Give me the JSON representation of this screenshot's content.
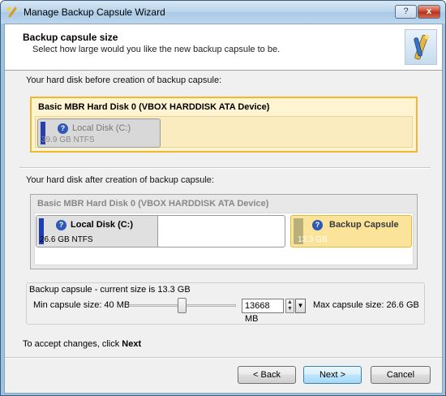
{
  "window": {
    "title": "Manage Backup Capsule Wizard",
    "help_label": "?",
    "close_label": "x"
  },
  "header": {
    "title": "Backup capsule size",
    "subtitle": "Select how large would you like the new backup capsule to be."
  },
  "before": {
    "label": "Your hard disk before creation of backup capsule:",
    "disk_name": "Basic MBR Hard Disk 0 (VBOX HARDDISK ATA Device)",
    "partitions": [
      {
        "name": "Local Disk (C:)",
        "size": "39.9 GB NTFS"
      }
    ]
  },
  "after": {
    "label": "Your hard disk after creation of backup capsule:",
    "disk_name": "Basic MBR Hard Disk 0 (VBOX HARDDISK ATA Device)",
    "partitions": [
      {
        "name": "Local Disk (C:)",
        "size": "26.6 GB NTFS"
      },
      {
        "name": "Backup Capsule",
        "size": "13.3 GB"
      }
    ]
  },
  "capsule": {
    "group_title": "Backup capsule - current size is 13.3 GB",
    "min_label": "Min capsule size:  40 MB",
    "max_label": "Max capsule size:  26.6 GB",
    "size_value": "13668 MB",
    "slider_fraction": 0.5
  },
  "accept": {
    "prefix": "To accept changes, click ",
    "bold": "Next"
  },
  "buttons": {
    "back": "< Back",
    "next": "Next >",
    "cancel": "Cancel"
  },
  "icons": {
    "title": "wizard-wand-icon",
    "header": "capsule-logo-icon",
    "partition": "question-icon"
  }
}
